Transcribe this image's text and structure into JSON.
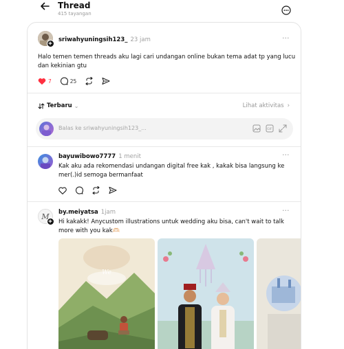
{
  "header": {
    "title": "Thread",
    "views": "415 tayangan"
  },
  "post": {
    "username": "sriwahyuningsih123_",
    "time": "23 jam",
    "text_line1": "Halo temen temen threads aku lagi cari undangan online bukan tema adat tp yang lucu",
    "text_line2": "dan kekinian gtu",
    "likes": "7",
    "replies": "25"
  },
  "sort": {
    "label": "Terbaru",
    "activity_label": "Lihat aktivitas"
  },
  "reply_box": {
    "placeholder": "Balas ke sriwahyuningsih123_..."
  },
  "replies": [
    {
      "username": "bayuwibowo7777",
      "time": "1 menit",
      "text_line1": "Kak aku ada rekomendasi undangan digital free kak , kakak bisa langsung ke",
      "text_line2": "mer(.)id semoga bermanfaat"
    },
    {
      "username": "by.meiyatsa",
      "time": "1jam",
      "text_line1": "Hi kakakk! Anycustom illustrations untuk wedding aku bisa, can't wait to talk",
      "text_line2": "more with you kak🫶🏻"
    }
  ],
  "colors": {
    "like": "#ff3040",
    "muted": "#999999",
    "border": "#e3e3e3"
  },
  "icons": [
    "back-arrow-icon",
    "more-circle-icon",
    "heart-icon",
    "comment-icon",
    "repost-icon",
    "share-icon",
    "sort-icon",
    "gif-icon",
    "image-icon",
    "expand-icon",
    "plus-badge-icon"
  ]
}
